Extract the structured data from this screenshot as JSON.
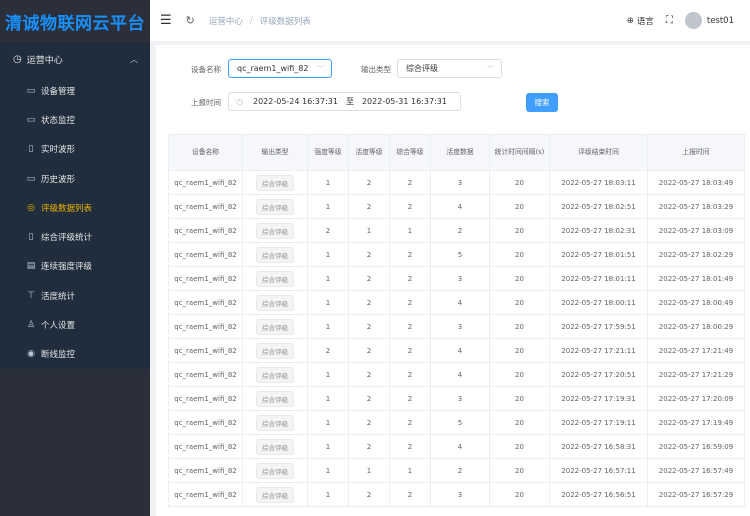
{
  "brand": "清诚物联网云平台",
  "sidebar": {
    "group_label": "运营中心",
    "items": [
      {
        "label": "设备管理",
        "icon": "monitor-icon"
      },
      {
        "label": "状态监控",
        "icon": "monitor-icon"
      },
      {
        "label": "实时波形",
        "icon": "panel-icon"
      },
      {
        "label": "历史波形",
        "icon": "monitor-icon"
      },
      {
        "label": "评级数据列表",
        "icon": "compass-icon",
        "active": true
      },
      {
        "label": "综合评级统计",
        "icon": "panel-icon"
      },
      {
        "label": "连续强度评级",
        "icon": "list-icon"
      },
      {
        "label": "活度统计",
        "icon": "pin-icon"
      },
      {
        "label": "个人设置",
        "icon": "user-icon"
      },
      {
        "label": "断线监控",
        "icon": "check-circle-icon"
      }
    ]
  },
  "topbar": {
    "breadcrumb": [
      "运营中心",
      "评级数据列表"
    ],
    "lang_label": "语言",
    "username": "test01"
  },
  "filters": {
    "device_label": "设备名称",
    "device_value": "qc_raem1_wifi_82",
    "output_label": "输出类型",
    "output_value": "综合评级",
    "time_label": "上报时间",
    "start_time": "2022-05-24 16:37:31",
    "range_sep": "至",
    "end_time": "2022-05-31 16:37:31",
    "search_label": "搜索"
  },
  "table": {
    "headers": [
      "设备名称",
      "输出类型",
      "强度等级",
      "活度等级",
      "综合等级",
      "活度数据",
      "统计时间间隔(s)",
      "评级结束时间",
      "上报时间"
    ],
    "rows": [
      [
        "qc_raem1_wifi_82",
        "综合评级",
        "1",
        "2",
        "2",
        "3",
        "20",
        "2022-05-27 18:03:11",
        "2022-05-27 18:03:49"
      ],
      [
        "qc_raem1_wifi_82",
        "综合评级",
        "1",
        "2",
        "2",
        "4",
        "20",
        "2022-05-27 18:02:51",
        "2022-05-27 18:03:29"
      ],
      [
        "qc_raem1_wifi_82",
        "综合评级",
        "2",
        "1",
        "1",
        "2",
        "20",
        "2022-05-27 18:02:31",
        "2022-05-27 18:03:09"
      ],
      [
        "qc_raem1_wifi_82",
        "综合评级",
        "1",
        "2",
        "2",
        "5",
        "20",
        "2022-05-27 18:01:51",
        "2022-05-27 18:02:29"
      ],
      [
        "qc_raem1_wifi_82",
        "综合评级",
        "1",
        "2",
        "2",
        "3",
        "20",
        "2022-05-27 18:01:11",
        "2022-05-27 18:01:49"
      ],
      [
        "qc_raem1_wifi_82",
        "综合评级",
        "1",
        "2",
        "2",
        "4",
        "20",
        "2022-05-27 18:00:11",
        "2022-05-27 18:00:49"
      ],
      [
        "qc_raem1_wifi_82",
        "综合评级",
        "1",
        "2",
        "2",
        "3",
        "20",
        "2022-05-27 17:59:51",
        "2022-05-27 18:00:29"
      ],
      [
        "qc_raem1_wifi_82",
        "综合评级",
        "2",
        "2",
        "2",
        "4",
        "20",
        "2022-05-27 17:21:11",
        "2022-05-27 17:21:49"
      ],
      [
        "qc_raem1_wifi_82",
        "综合评级",
        "1",
        "2",
        "2",
        "4",
        "20",
        "2022-05-27 17:20:51",
        "2022-05-27 17:21:29"
      ],
      [
        "qc_raem1_wifi_82",
        "综合评级",
        "1",
        "2",
        "2",
        "3",
        "20",
        "2022-05-27 17:19:31",
        "2022-05-27 17:20:09"
      ],
      [
        "qc_raem1_wifi_82",
        "综合评级",
        "1",
        "2",
        "2",
        "5",
        "20",
        "2022-05-27 17:19:11",
        "2022-05-27 17:19:49"
      ],
      [
        "qc_raem1_wifi_82",
        "综合评级",
        "1",
        "2",
        "2",
        "4",
        "20",
        "2022-05-27 16:58:31",
        "2022-05-27 16:59:09"
      ],
      [
        "qc_raem1_wifi_82",
        "综合评级",
        "1",
        "1",
        "1",
        "2",
        "20",
        "2022-05-27 16:57:11",
        "2022-05-27 16:57:49"
      ],
      [
        "qc_raem1_wifi_82",
        "综合评级",
        "1",
        "2",
        "2",
        "3",
        "20",
        "2022-05-27 16:56:51",
        "2022-05-27 16:57:29"
      ]
    ]
  }
}
